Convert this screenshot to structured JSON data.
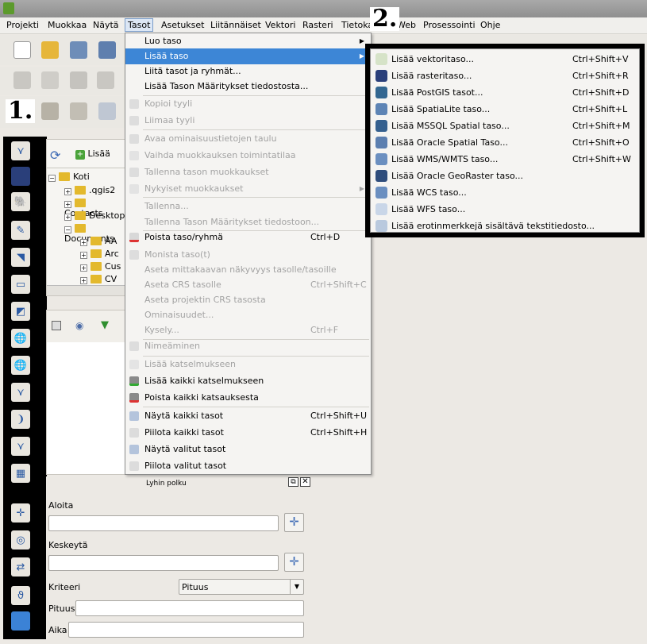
{
  "menubar": [
    "Projekti",
    "Muokkaa",
    "Näytä",
    "Tasot",
    "Asetukset",
    "Liitännäiset",
    "Vektori",
    "Rasteri",
    "Tietokanta",
    "Web",
    "Prosessointi",
    "Ohje"
  ],
  "annotations": {
    "one": "1.",
    "two": "2."
  },
  "layers_panel": {
    "add_label": "Lisää"
  },
  "browser_tree": [
    {
      "label": "Koti"
    },
    {
      "label": ".qgis2"
    },
    {
      "label": "Contacts"
    },
    {
      "label": "Desktop"
    },
    {
      "label": "Documents"
    },
    {
      "label": "AA"
    },
    {
      "label": "Arc"
    },
    {
      "label": "Cus"
    },
    {
      "label": "CV"
    }
  ],
  "tasot_menu": [
    {
      "label": "Luo taso",
      "shortcut": "",
      "state": "normal",
      "submenu": true
    },
    {
      "label": "Lisää taso",
      "shortcut": "",
      "state": "highlight",
      "submenu": true
    },
    {
      "label": "Liitä tasot ja ryhmät...",
      "shortcut": "",
      "state": "normal"
    },
    {
      "label": "Lisää Tason Määritykset tiedostosta...",
      "shortcut": "",
      "state": "normal"
    },
    {
      "label": "Kopioi tyyli",
      "shortcut": "",
      "state": "disabled"
    },
    {
      "label": "Liimaa tyyli",
      "shortcut": "",
      "state": "disabled"
    },
    {
      "label": "Avaa ominaisuustietojen taulu",
      "shortcut": "",
      "state": "disabled"
    },
    {
      "label": "Vaihda muokkauksen toimintatilaa",
      "shortcut": "",
      "state": "disabled"
    },
    {
      "label": "Tallenna tason muokkaukset",
      "shortcut": "",
      "state": "disabled"
    },
    {
      "label": "Nykyiset muokkaukset",
      "shortcut": "",
      "state": "disabled",
      "submenu": true
    },
    {
      "label": "Tallenna...",
      "shortcut": "",
      "state": "disabled"
    },
    {
      "label": "Tallenna Tason Määritykset tiedostoon...",
      "shortcut": "",
      "state": "disabled"
    },
    {
      "label": "Poista taso/ryhmä",
      "shortcut": "Ctrl+D",
      "state": "normal"
    },
    {
      "label": "Monista taso(t)",
      "shortcut": "",
      "state": "disabled"
    },
    {
      "label": "Aseta mittakaavan näkyvyys tasolle/tasoille",
      "shortcut": "",
      "state": "disabled"
    },
    {
      "label": "Aseta CRS tasolle",
      "shortcut": "Ctrl+Shift+C",
      "state": "disabled"
    },
    {
      "label": "Aseta projektin CRS tasosta",
      "shortcut": "",
      "state": "disabled"
    },
    {
      "label": "Ominaisuudet...",
      "shortcut": "",
      "state": "disabled"
    },
    {
      "label": "Kysely...",
      "shortcut": "Ctrl+F",
      "state": "disabled"
    },
    {
      "label": "Nimeäminen",
      "shortcut": "",
      "state": "disabled"
    },
    {
      "label": "Lisää katselmukseen",
      "shortcut": "",
      "state": "disabled"
    },
    {
      "label": "Lisää kaikki katselmukseen",
      "shortcut": "",
      "state": "normal"
    },
    {
      "label": "Poista kaikki katsauksesta",
      "shortcut": "",
      "state": "normal"
    },
    {
      "label": "Näytä kaikki tasot",
      "shortcut": "Ctrl+Shift+U",
      "state": "normal"
    },
    {
      "label": "Piilota kaikki tasot",
      "shortcut": "Ctrl+Shift+H",
      "state": "normal"
    },
    {
      "label": "Näytä valitut tasot",
      "shortcut": "",
      "state": "normal"
    },
    {
      "label": "Piilota valitut tasot",
      "shortcut": "",
      "state": "normal"
    }
  ],
  "lisaa_taso_submenu": [
    {
      "label": "Lisää vektoritaso...",
      "shortcut": "Ctrl+Shift+V"
    },
    {
      "label": "Lisää rasteritaso...",
      "shortcut": "Ctrl+Shift+R"
    },
    {
      "label": "Lisää PostGIS tasot...",
      "shortcut": "Ctrl+Shift+D"
    },
    {
      "label": "Lisää SpatiaLite taso...",
      "shortcut": "Ctrl+Shift+L"
    },
    {
      "label": "Lisää MSSQL Spatial taso...",
      "shortcut": "Ctrl+Shift+M"
    },
    {
      "label": "Lisää Oracle Spatial Taso...",
      "shortcut": "Ctrl+Shift+O"
    },
    {
      "label": "Lisää WMS/WMTS taso...",
      "shortcut": "Ctrl+Shift+W"
    },
    {
      "label": "Lisää Oracle GeoRaster taso...",
      "shortcut": ""
    },
    {
      "label": "Lisää WCS taso...",
      "shortcut": ""
    },
    {
      "label": "Lisää WFS taso...",
      "shortcut": ""
    },
    {
      "label": "Lisää erotinmerkkejä sisältävä tekstitiedosto...",
      "shortcut": ""
    }
  ],
  "shortest_path": {
    "title": "Lyhin polku",
    "start_label": "Aloita",
    "stop_label": "Keskeytä",
    "criterion_label": "Kriteeri",
    "criterion_value": "Pituus",
    "length_label": "Pituus",
    "time_label": "Aika"
  }
}
